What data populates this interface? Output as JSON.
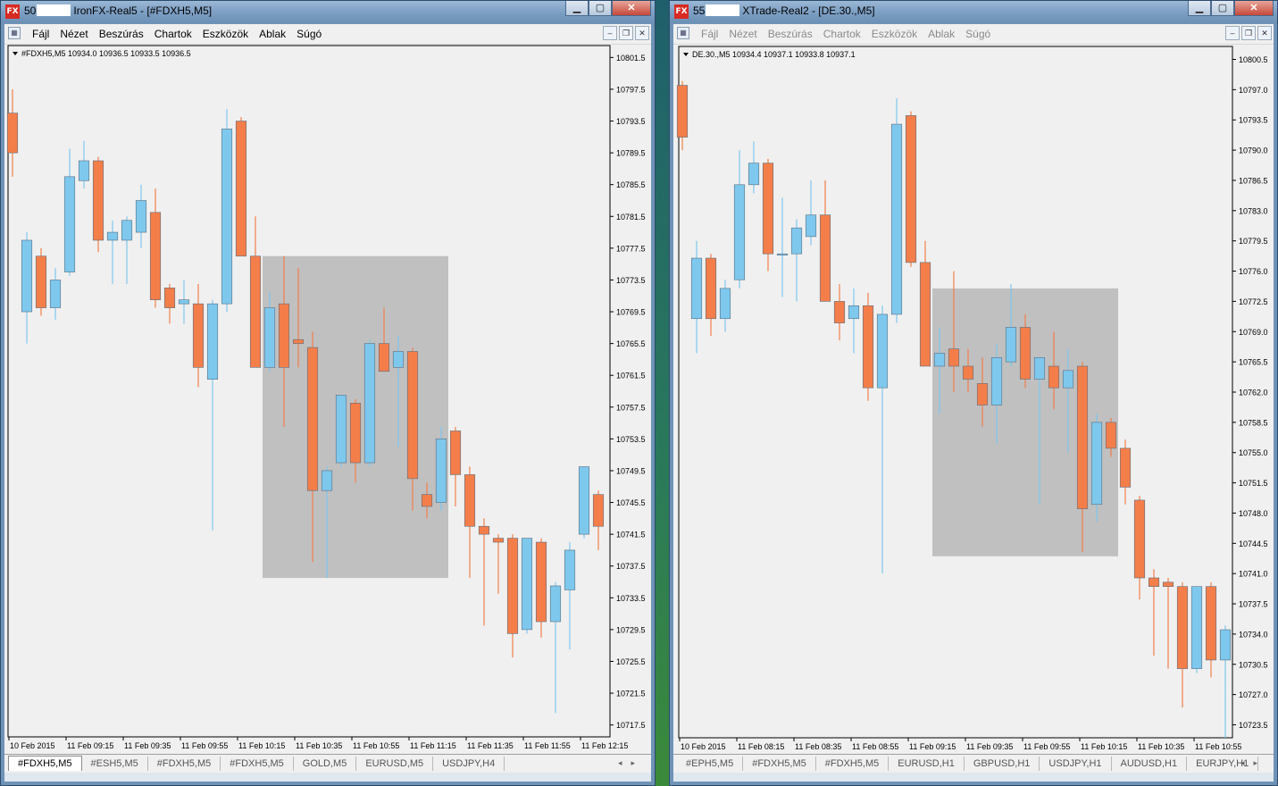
{
  "left_window": {
    "title_prefix": "50",
    "title_suffix": "IronFX-Real5 - [#FDXH5,M5]",
    "menu": [
      "Fájl",
      "Nézet",
      "Beszúrás",
      "Chartok",
      "Eszközök",
      "Ablak",
      "Súgó"
    ],
    "tabs": [
      "#FDXH5,M5",
      "#ESH5,M5",
      "#FDXH5,M5",
      "#FDXH5,M5",
      "GOLD,M5",
      "EURUSD,M5",
      "USDJPY,H4"
    ],
    "active_tab": 0,
    "chart_header": "#FDXH5,M5  10934.0 10936.5 10933.5 10936.5"
  },
  "right_window": {
    "title_prefix": "55",
    "title_suffix": "XTrade-Real2 - [DE.30.,M5]",
    "menu": [
      "Fájl",
      "Nézet",
      "Beszúrás",
      "Chartok",
      "Eszközök",
      "Ablak",
      "Súgó"
    ],
    "tabs": [
      "#EPH5,M5",
      "#FDXH5,M5",
      "#FDXH5,M5",
      "EURUSD,H1",
      "GBPUSD,H1",
      "USDJPY,H1",
      "AUDUSD,H1",
      "EURJPY,H1"
    ],
    "active_tab": -1,
    "chart_header": "DE.30.,M5  10934.4 10937.1 10933.8 10937.1"
  },
  "colors": {
    "bull": "#7ec8ee",
    "bear": "#f47e4a",
    "highlight": "#c0c0c0",
    "chart_bg": "#f0f0f0"
  },
  "chart_data": [
    {
      "type": "candlestick",
      "symbol": "#FDXH5,M5",
      "ylim": [
        10716,
        10803
      ],
      "y_ticks": [
        "10801.5",
        "10797.5",
        "10793.5",
        "10789.5",
        "10785.5",
        "10781.5",
        "10777.5",
        "10773.5",
        "10769.5",
        "10765.5",
        "10761.5",
        "10757.5",
        "10753.5",
        "10749.5",
        "10745.5",
        "10741.5",
        "10737.5",
        "10733.5",
        "10729.5",
        "10725.5",
        "10721.5",
        "10717.5"
      ],
      "x_ticks": [
        "10 Feb 2015",
        "11 Feb 09:15",
        "11 Feb 09:35",
        "11 Feb 09:55",
        "11 Feb 10:15",
        "11 Feb 10:35",
        "11 Feb 10:55",
        "11 Feb 11:15",
        "11 Feb 11:35",
        "11 Feb 11:55",
        "11 Feb 12:15"
      ],
      "highlight_range": {
        "from_candle": 18,
        "to_candle": 30,
        "y_low": 10736,
        "y_high": 10776.5
      },
      "candles": [
        {
          "o": 10794.5,
          "h": 10797.5,
          "l": 10786.5,
          "c": 10789.5
        },
        {
          "o": 10769.5,
          "h": 10779.5,
          "l": 10765.5,
          "c": 10778.5
        },
        {
          "o": 10776.5,
          "h": 10777.5,
          "l": 10769,
          "c": 10770
        },
        {
          "o": 10770,
          "h": 10775,
          "l": 10768.5,
          "c": 10773.5
        },
        {
          "o": 10774.5,
          "h": 10790,
          "l": 10774,
          "c": 10786.5
        },
        {
          "o": 10786,
          "h": 10791,
          "l": 10785,
          "c": 10788.5
        },
        {
          "o": 10788.5,
          "h": 10789,
          "l": 10777,
          "c": 10778.5
        },
        {
          "o": 10778.5,
          "h": 10781,
          "l": 10773,
          "c": 10779.5
        },
        {
          "o": 10778.5,
          "h": 10781.5,
          "l": 10773,
          "c": 10781
        },
        {
          "o": 10779.5,
          "h": 10785.5,
          "l": 10777.5,
          "c": 10783.5
        },
        {
          "o": 10782,
          "h": 10785,
          "l": 10770,
          "c": 10771
        },
        {
          "o": 10772.5,
          "h": 10773,
          "l": 10768,
          "c": 10770
        },
        {
          "o": 10770.5,
          "h": 10773.5,
          "l": 10768,
          "c": 10771
        },
        {
          "o": 10770.5,
          "h": 10773,
          "l": 10760,
          "c": 10762.5
        },
        {
          "o": 10761,
          "h": 10771,
          "l": 10742,
          "c": 10770.5
        },
        {
          "o": 10770.5,
          "h": 10795,
          "l": 10769.5,
          "c": 10792.5
        },
        {
          "o": 10793.5,
          "h": 10794,
          "l": 10776.5,
          "c": 10776.5
        },
        {
          "o": 10776.5,
          "h": 10781.5,
          "l": 10762.5,
          "c": 10762.5
        },
        {
          "o": 10762.5,
          "h": 10772,
          "l": 10762,
          "c": 10770
        },
        {
          "o": 10770.5,
          "h": 10776.5,
          "l": 10755,
          "c": 10762.5
        },
        {
          "o": 10766,
          "h": 10775,
          "l": 10762.5,
          "c": 10765.5
        },
        {
          "o": 10765,
          "h": 10767,
          "l": 10738,
          "c": 10747
        },
        {
          "o": 10747,
          "h": 10750,
          "l": 10736,
          "c": 10749.5
        },
        {
          "o": 10750.5,
          "h": 10759,
          "l": 10750,
          "c": 10759
        },
        {
          "o": 10758,
          "h": 10758.5,
          "l": 10748,
          "c": 10750.5
        },
        {
          "o": 10750.5,
          "h": 10766,
          "l": 10750,
          "c": 10765.5
        },
        {
          "o": 10765.5,
          "h": 10770,
          "l": 10762,
          "c": 10762
        },
        {
          "o": 10762.5,
          "h": 10766.5,
          "l": 10752.5,
          "c": 10764.5
        },
        {
          "o": 10764.5,
          "h": 10765,
          "l": 10744.5,
          "c": 10748.5
        },
        {
          "o": 10746.5,
          "h": 10748,
          "l": 10743.5,
          "c": 10745
        },
        {
          "o": 10745.5,
          "h": 10755,
          "l": 10744.5,
          "c": 10753.5
        },
        {
          "o": 10754.5,
          "h": 10755,
          "l": 10745,
          "c": 10749
        },
        {
          "o": 10749,
          "h": 10750,
          "l": 10736,
          "c": 10742.5
        },
        {
          "o": 10742.5,
          "h": 10743.5,
          "l": 10730,
          "c": 10741.5
        },
        {
          "o": 10741,
          "h": 10741.5,
          "l": 10734,
          "c": 10740.5
        },
        {
          "o": 10741,
          "h": 10741.5,
          "l": 10726,
          "c": 10729
        },
        {
          "o": 10729.5,
          "h": 10741,
          "l": 10729,
          "c": 10741
        },
        {
          "o": 10740.5,
          "h": 10741,
          "l": 10728.5,
          "c": 10730.5
        },
        {
          "o": 10730.5,
          "h": 10735.5,
          "l": 10719,
          "c": 10735
        },
        {
          "o": 10734.5,
          "h": 10740.5,
          "l": 10727,
          "c": 10739.5
        },
        {
          "o": 10741.5,
          "h": 10750,
          "l": 10741,
          "c": 10750
        },
        {
          "o": 10746.5,
          "h": 10747,
          "l": 10739.5,
          "c": 10742.5
        }
      ]
    },
    {
      "type": "candlestick",
      "symbol": "DE.30.,M5",
      "ylim": [
        10722,
        10802
      ],
      "y_ticks": [
        "10800.5",
        "10797.0",
        "10793.5",
        "10790.0",
        "10786.5",
        "10783.0",
        "10779.5",
        "10776.0",
        "10772.5",
        "10769.0",
        "10765.5",
        "10762.0",
        "10758.5",
        "10755.0",
        "10751.5",
        "10748.0",
        "10744.5",
        "10741.0",
        "10737.5",
        "10734.0",
        "10730.5",
        "10727.0",
        "10723.5"
      ],
      "x_ticks": [
        "10 Feb 2015",
        "11 Feb 08:15",
        "11 Feb 08:35",
        "11 Feb 08:55",
        "11 Feb 09:15",
        "11 Feb 09:35",
        "11 Feb 09:55",
        "11 Feb 10:15",
        "11 Feb 10:35",
        "11 Feb 10:55"
      ],
      "highlight_range": {
        "from_candle": 18,
        "to_candle": 30,
        "y_low": 10743,
        "y_high": 10774
      },
      "candles": [
        {
          "o": 10797.5,
          "h": 10798,
          "l": 10790,
          "c": 10791.5
        },
        {
          "o": 10770.5,
          "h": 10779.5,
          "l": 10766.5,
          "c": 10777.5
        },
        {
          "o": 10777.5,
          "h": 10778,
          "l": 10768.5,
          "c": 10770.5
        },
        {
          "o": 10770.5,
          "h": 10775,
          "l": 10769,
          "c": 10774
        },
        {
          "o": 10775,
          "h": 10790,
          "l": 10774,
          "c": 10786
        },
        {
          "o": 10786,
          "h": 10791,
          "l": 10785,
          "c": 10788.5
        },
        {
          "o": 10788.5,
          "h": 10789,
          "l": 10776,
          "c": 10778
        },
        {
          "o": 10778,
          "h": 10784.5,
          "l": 10773,
          "c": 10778
        },
        {
          "o": 10778,
          "h": 10782,
          "l": 10772.5,
          "c": 10781
        },
        {
          "o": 10780,
          "h": 10786.5,
          "l": 10779,
          "c": 10782.5
        },
        {
          "o": 10782.5,
          "h": 10786.5,
          "l": 10772.5,
          "c": 10772.5
        },
        {
          "o": 10772.5,
          "h": 10774.5,
          "l": 10768,
          "c": 10770
        },
        {
          "o": 10770.5,
          "h": 10774,
          "l": 10766.5,
          "c": 10772
        },
        {
          "o": 10772,
          "h": 10773.5,
          "l": 10761,
          "c": 10762.5
        },
        {
          "o": 10762.5,
          "h": 10772,
          "l": 10741,
          "c": 10771
        },
        {
          "o": 10771,
          "h": 10796,
          "l": 10770,
          "c": 10793
        },
        {
          "o": 10794,
          "h": 10794.5,
          "l": 10776.5,
          "c": 10777
        },
        {
          "o": 10777,
          "h": 10779.5,
          "l": 10765,
          "c": 10765
        },
        {
          "o": 10765,
          "h": 10769.5,
          "l": 10759.5,
          "c": 10766.5
        },
        {
          "o": 10767,
          "h": 10776,
          "l": 10762,
          "c": 10765
        },
        {
          "o": 10765,
          "h": 10767,
          "l": 10762,
          "c": 10763.5
        },
        {
          "o": 10763,
          "h": 10766,
          "l": 10758,
          "c": 10760.5
        },
        {
          "o": 10760.5,
          "h": 10767.5,
          "l": 10756,
          "c": 10766
        },
        {
          "o": 10765.5,
          "h": 10774.5,
          "l": 10765,
          "c": 10769.5
        },
        {
          "o": 10769.5,
          "h": 10771,
          "l": 10762.5,
          "c": 10763.5
        },
        {
          "o": 10763.5,
          "h": 10766,
          "l": 10749,
          "c": 10766
        },
        {
          "o": 10765,
          "h": 10769,
          "l": 10760,
          "c": 10762.5
        },
        {
          "o": 10762.5,
          "h": 10767,
          "l": 10755,
          "c": 10764.5
        },
        {
          "o": 10765,
          "h": 10765.5,
          "l": 10743.5,
          "c": 10748.5
        },
        {
          "o": 10749,
          "h": 10759.5,
          "l": 10747,
          "c": 10758.5
        },
        {
          "o": 10758.5,
          "h": 10759,
          "l": 10754.5,
          "c": 10755.5
        },
        {
          "o": 10755.5,
          "h": 10756.5,
          "l": 10749,
          "c": 10751
        },
        {
          "o": 10749.5,
          "h": 10750,
          "l": 10738,
          "c": 10740.5
        },
        {
          "o": 10740.5,
          "h": 10741.5,
          "l": 10731.5,
          "c": 10739.5
        },
        {
          "o": 10740,
          "h": 10740.5,
          "l": 10730,
          "c": 10739.5
        },
        {
          "o": 10739.5,
          "h": 10740,
          "l": 10725.5,
          "c": 10730
        },
        {
          "o": 10730,
          "h": 10739.5,
          "l": 10729.5,
          "c": 10739.5
        },
        {
          "o": 10739.5,
          "h": 10740,
          "l": 10729,
          "c": 10731
        },
        {
          "o": 10731,
          "h": 10735,
          "l": 10722,
          "c": 10734.5
        }
      ]
    }
  ]
}
